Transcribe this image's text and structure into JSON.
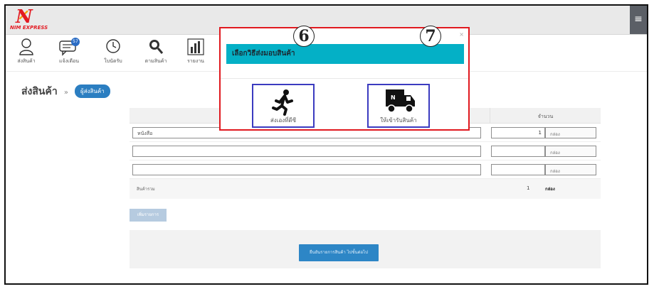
{
  "header": {
    "logo_mark": "N",
    "logo_text": "NIM EXPRESS",
    "menu_icon": "hamburger-icon"
  },
  "nav": {
    "items": [
      {
        "label": "ส่งสินค้า",
        "icon": "user-icon"
      },
      {
        "label": "แจ้งเตือน",
        "icon": "chat-icon",
        "badge": "57"
      },
      {
        "label": "ใบนัดรับ",
        "icon": "clock-icon"
      },
      {
        "label": "ตามสินค้า",
        "icon": "search-icon"
      },
      {
        "label": "รายงาน",
        "icon": "bar-chart-icon"
      }
    ]
  },
  "breadcrumb": {
    "title": "ส่งสินค้า",
    "separator": "»",
    "current": "ผู้ส่งสินค้า"
  },
  "form": {
    "qty_header": "จำนวน",
    "rows": [
      {
        "item": "หนังสือ",
        "qty": "1",
        "unit": "กล่อง"
      },
      {
        "item": "",
        "qty": "",
        "unit": "กล่อง"
      },
      {
        "item": "",
        "qty": "",
        "unit": "กล่อง"
      }
    ],
    "sum_label": "สินค้ารวม",
    "sum_qty": "1",
    "sum_unit": "กล่อง",
    "add_button": "เพิ่มรายการ",
    "submit_button": "ยืนยันรายการสินค้า ไปขั้นต่อไป"
  },
  "modal": {
    "close": "×",
    "title": "เลือกวิธีส่งมอบสินค้า",
    "options": [
      {
        "label": "ส่งเองที่ดีซี",
        "number": "6",
        "icon": "running-man-icon"
      },
      {
        "label": "ให้เข้ารับสินค้า",
        "number": "7",
        "icon": "delivery-truck-icon"
      }
    ]
  },
  "colors": {
    "modal_border": "#e0191f",
    "modal_header": "#04b0c6",
    "option_border": "#3b3bc0",
    "primary": "#2d86c6"
  }
}
